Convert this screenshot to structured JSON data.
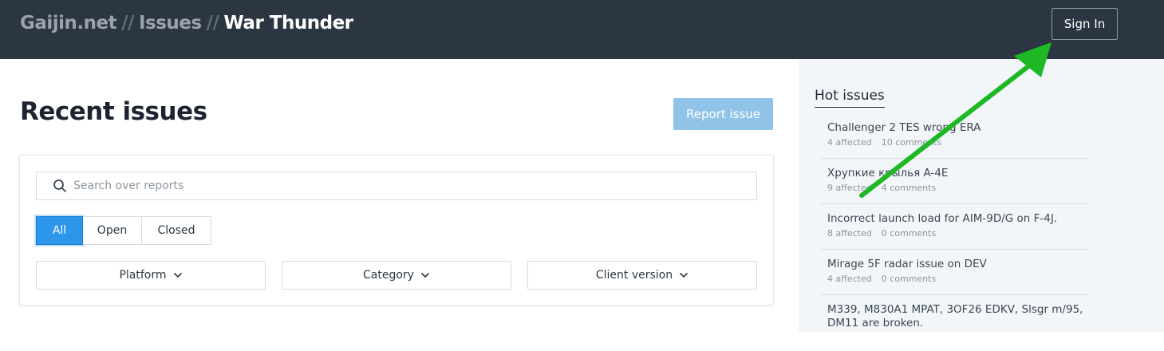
{
  "header": {
    "breadcrumb": [
      "Gaijin.net",
      "Issues",
      "War Thunder"
    ],
    "separator": "//",
    "signin_label": "Sign In"
  },
  "main": {
    "title": "Recent issues",
    "report_label": "Report issue",
    "search": {
      "placeholder": "Search over reports",
      "value": ""
    },
    "tabs": [
      {
        "label": "All",
        "active": true
      },
      {
        "label": "Open",
        "active": false
      },
      {
        "label": "Closed",
        "active": false
      }
    ],
    "filters": [
      {
        "label": "Platform",
        "icon": "chevron-down-icon"
      },
      {
        "label": "Category",
        "icon": "chevron-down-icon"
      },
      {
        "label": "Client version",
        "icon": "chevron-down-icon"
      }
    ]
  },
  "sidebar": {
    "title": "Hot issues",
    "items": [
      {
        "title": "Challenger 2 TES wrong ERA",
        "affected": "4 affected",
        "comments": "10 comments"
      },
      {
        "title": "Хрупкие крылья A-4E",
        "affected": "9 affected",
        "comments": "4 comments"
      },
      {
        "title": "Incorrect launch load for AIM-9D/G on F-4J.",
        "affected": "8 affected",
        "comments": "0 comments"
      },
      {
        "title": "Mirage 5F radar issue on DEV",
        "affected": "4 affected",
        "comments": "0 comments"
      },
      {
        "title": "M339, M830A1 MPAT, 3OF26 EDKV, Slsgr m/95, DM11 are broken.",
        "affected": "",
        "comments": ""
      }
    ]
  },
  "colors": {
    "header_bg": "#2b3642",
    "accent": "#2d96ea",
    "report_button": "#8fc3e8",
    "annotation_arrow": "#1db824"
  },
  "icons": {
    "search": "search-icon",
    "annotation": "green-arrow-annotation"
  }
}
